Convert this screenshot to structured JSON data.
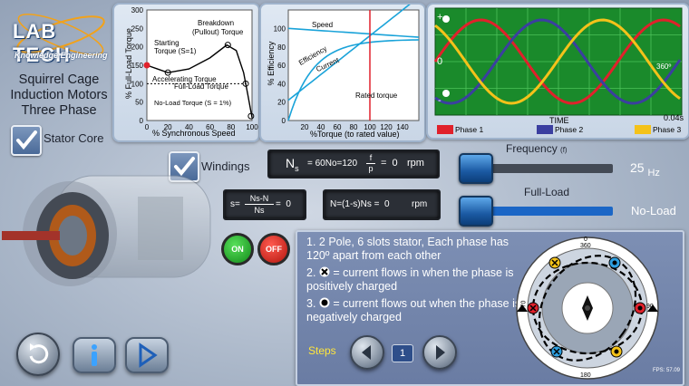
{
  "logo": {
    "main": "LAB TECH",
    "sub": "Knowledge Engineering"
  },
  "title": {
    "line1": "Squirrel Cage",
    "line2": "Induction Motors",
    "line3": "Three Phase"
  },
  "checkboxes": {
    "stator_core": "Stator Core",
    "windings": "Windings"
  },
  "torque_chart": {
    "ylabel": "% Full-Load Torque",
    "xlabel": "% Synchronous Speed",
    "yticks": [
      "0",
      "50",
      "100",
      "150",
      "200",
      "250",
      "300"
    ],
    "xticks": [
      "0",
      "20",
      "40",
      "60",
      "80",
      "100"
    ],
    "labels": {
      "breakdown": "Breakdown",
      "breakdown2": "(Pullout) Torque",
      "starting": "Starting",
      "starting2": "Torque (S=1)",
      "accelerating": "Accelerating Torque",
      "fullload": "Full-Load Torque",
      "noload": "No-Load Torque (S = 1%)"
    }
  },
  "efficiency_chart": {
    "ylabel": "% Efficiency",
    "xlabel": "%Torque (to rated value)",
    "yticks": [
      "0",
      "20",
      "40",
      "60",
      "80",
      "100"
    ],
    "xticks": [
      "20",
      "40",
      "60",
      "80",
      "100",
      "120",
      "140"
    ],
    "labels": {
      "speed": "Speed",
      "efficiency": "Efficiency",
      "current": "Current",
      "rated": "Rated torque"
    }
  },
  "phase_chart": {
    "ytop": "+",
    "ymid": "0",
    "ybot": "-",
    "xlabel": "TIME",
    "time_end": "0.04s",
    "angle": "360º",
    "legend": [
      {
        "label": "Phase 1",
        "color": "#e0212b"
      },
      {
        "label": "Phase 2",
        "color": "#3b3fa0"
      },
      {
        "label": "Phase 3",
        "color": "#f4c21a"
      }
    ]
  },
  "formulas": {
    "ns_lhs": "N",
    "ns_sub": "s",
    "ns_expr": "= 60No=120",
    "ns_frac_num": "f",
    "ns_frac_den": "p",
    "ns_val": "=  0",
    "ns_unit": "rpm",
    "slip_lhs": "s=",
    "slip_num": "Ns-N",
    "slip_den": "Ns",
    "slip_val": "=  0",
    "n_expr": "N=(1-s)Ns =  0",
    "n_unit": "rpm"
  },
  "frequency": {
    "label": "Frequency",
    "sym": "(f)",
    "value": "25",
    "unit": "Hz"
  },
  "load": {
    "label": "Full-Load",
    "value": "No-Load"
  },
  "power": {
    "on": "ON",
    "off": "OFF"
  },
  "info": {
    "item1": "1. 2 Pole, 6 slots stator, Each phase has 120º apart from each other",
    "item2_num": "2.",
    "item2_text": "= current flows in when the phase is positively charged",
    "item3_num": "3.",
    "item3_text": "= current flows out when the phase is negatively charged",
    "steps_label": "Steps",
    "step_value": "1"
  },
  "dial": {
    "top": "0",
    "top2": "360",
    "right": "90",
    "bottom": "180",
    "left": "270",
    "fps": "FPS: 57.09"
  }
}
